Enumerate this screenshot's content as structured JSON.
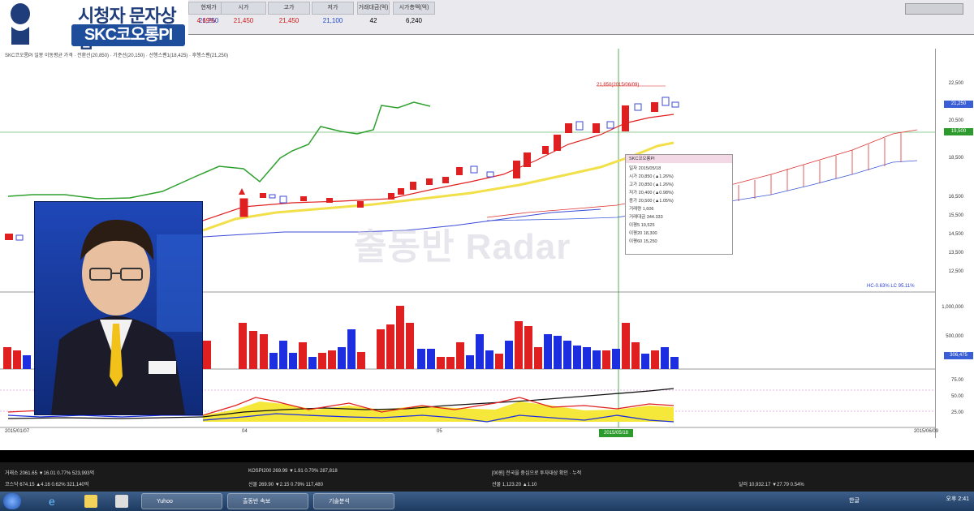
{
  "logo": {
    "line1": "시청자 문자상담",
    "line2": "SKC코오롱PI"
  },
  "quote": {
    "cells": [
      {
        "label": "현재가",
        "value": "21,250",
        "color": "#1f48c8"
      },
      {
        "label": "",
        "value": "",
        "color": "#333"
      },
      {
        "label": "",
        "value": "4.69%",
        "color": "#d21a1a"
      },
      {
        "label": "시가",
        "value": "21,450",
        "color": "#d21a1a"
      },
      {
        "label": "고가",
        "value": "21,450",
        "color": "#d21a1a"
      },
      {
        "label": "저가",
        "value": "21,100",
        "color": "#1f48c8"
      },
      {
        "label": "거래대금(억)",
        "value": "42",
        "color": "#222"
      },
      {
        "label": "시가총액(억)",
        "value": "6,240",
        "color": "#222"
      }
    ]
  },
  "legend": "SKC코오롱PI 일봉 이동평균 가격 · 전환선(20,850) · 기준선(20,150) · 선행스팬1(18,425) · 후행스팬(21,250)",
  "watermark": "출동반 Radar",
  "price_high_label": "21,850(2015/06/09)",
  "popup": {
    "title": "SKC코오롱PI",
    "rows": [
      "일자 2015/05/18",
      "시가 20,850 (▲1.26%)",
      "고가 20,850 (▲1.26%)",
      "저가 20,400 (▲0.98%)",
      "종가 20,500 (▲1.05%)",
      "거래량 1,606",
      "거래대금 344.333",
      "이평5 19,525",
      "이평20 18,300",
      "이평60 15,250"
    ]
  },
  "y_axis": {
    "ticks": [
      "22,500",
      "20,500",
      "18,500",
      "16,500",
      "15,500",
      "14,500",
      "13,500",
      "12,500",
      "1,000,000",
      "500,000",
      "75.00",
      "50.00",
      "25.00"
    ],
    "current_tag": "21,250",
    "tag2": "19,500",
    "volume_tag": "306,475"
  },
  "hc_lc": "HC-0.63% LC 95.11%",
  "date_labels": {
    "left": "2015/01/07",
    "mid1": "04",
    "mid2": "05",
    "right": "2015/06/09"
  },
  "date_tag": "2015/05/18",
  "status": {
    "rows": [
      "거래소 2061.65 ▼16.01 0.77% 523,993억",
      "코스닥 674.15 ▲4.16 0.62% 321,140억"
    ],
    "rows2": [
      "KOSPI200 269.99 ▼1.91 0.70% 287,818",
      "선물 269.90 ▼2.15 0.79% 117,480"
    ],
    "rows3": "[00원] 전국을 중심으로 투자대상 확인 · 누적",
    "rows4": "선물 1,123.20 ▲1.10",
    "right": "달러 10,932.17 ▼27.79 0.54%"
  },
  "taskbar": {
    "items": [
      "Yuhoo",
      "출동반 속보",
      "기술분석"
    ],
    "time": "오후 2:41",
    "lang": "한글"
  },
  "chart_data": {
    "type": "line",
    "title": "",
    "xlabel": "",
    "ylabel": "",
    "ylim": [
      12000,
      23000
    ],
    "x": [
      "2015/01/07",
      "04",
      "05",
      "2015/06/09"
    ],
    "series": [
      {
        "name": "전환선",
        "values": [
          16000,
          17500,
          19500,
          20850
        ]
      },
      {
        "name": "기준선",
        "values": [
          15500,
          16800,
          18300,
          20150
        ]
      },
      {
        "name": "후행스팬",
        "values": [
          16500,
          18000,
          20500,
          21250
        ]
      }
    ],
    "grid": true,
    "legend": "top-left"
  }
}
